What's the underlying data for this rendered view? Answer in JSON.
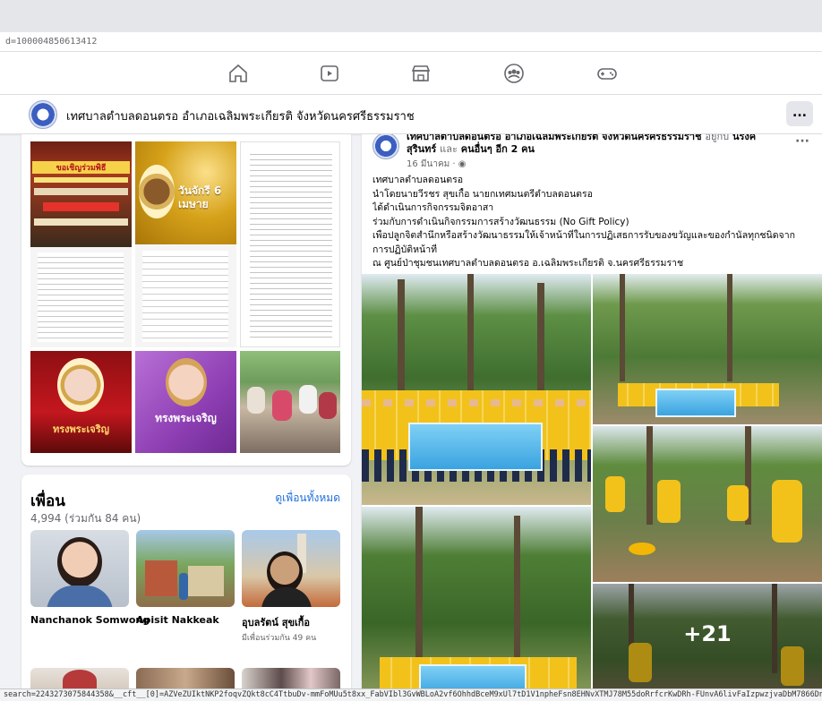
{
  "browser": {
    "url_fragment": "d=100004850613412",
    "status_url": "search=2243273075844358&__cft__[0]=AZVeZUIktNKP2foqvZQkt8cC4TtbuDv-mmFoMUu5t8xx_FabVIbl3GvWBLoA2vf6OhhdBceM9xUl7tD1V1npheFsn8EHNvXTMJ78M55doRrfcrKwDRh-FUnvA6livFaIzpwzjvaDbM7866DncBuP"
  },
  "nav": {
    "icons": [
      "home-icon",
      "watch-icon",
      "marketplace-icon",
      "groups-icon",
      "gaming-icon"
    ]
  },
  "page_header": {
    "title": "เทศบาลตำบลดอนตรอ อำเภอเฉลิมพระเกียรติ จังหวัดนครศรีธรรมราช",
    "more": "..."
  },
  "photos": {
    "tiles": [
      {
        "caption": "",
        "overlay_text": "ขอเชิญร่วมพิธี"
      },
      {
        "caption": "",
        "overlay_text": "วันจักรี 6 เมษาย"
      },
      {
        "caption": "",
        "overlay_text": ""
      },
      {
        "caption": "",
        "overlay_text": ""
      },
      {
        "caption": "",
        "overlay_text": ""
      },
      {
        "caption": "",
        "overlay_text": ""
      },
      {
        "caption": "",
        "overlay_text": "ทรงพระเจริญ"
      },
      {
        "caption": "",
        "overlay_text": "ทรงพระเจริญ"
      },
      {
        "caption": "",
        "overlay_text": ""
      }
    ]
  },
  "friends": {
    "title": "เพื่อน",
    "count": "4,994 (ร่วมกัน 84 คน)",
    "see_all": "ดูเพื่อนทั้งหมด",
    "items": [
      {
        "name": "Nanchanok Somwong",
        "mutual": ""
      },
      {
        "name": "Apisit Nakkeak",
        "mutual": ""
      },
      {
        "name": "อุบลรัตน์ สุขเกื้อ",
        "mutual": "มีเพื่อนร่วมกัน 49 คน"
      }
    ]
  },
  "post": {
    "author_line": "เทศบาลตำบลดอนตรอ อำเภอเฉลิมพระเกียรติ จังหวัดนครศรีธรรมราช",
    "with_text": "อยู่กับ",
    "tagged": "นรงค์ สุรินทร์",
    "and_text": "และ",
    "others": "คนอื่นๆ อีก 2 คน",
    "time": "16 มีนาคม · ",
    "more": "···",
    "lines": [
      "เทศบาลตำบลดอนตรอ",
      "นำโดยนายวีรชร สุขเกื้อ นายกเทศมนตรีตำบลดอนตรอ",
      "ได้ดำเนินการกิจกรรมจิตอาสา",
      "ร่วมกับการดำเนินกิจกรรมการสร้างวัฒนธรรม (No Gift Policy)",
      "เพื่อปลูกจิตสำนึกหรือสร้างวัฒนาธรรมให้เจ้าหน้าที่ในการปฏิเสธการรับของขวัญและของกำนัลทุกชนิดจาก",
      "การปฏิบัติหน้าที่",
      "ณ ศูนย์ป่าชุมชนเทศบาลตำบลดอนตรอ อ.เฉลิมพระเกียรติ จ.นครศรีธรรมราช"
    ],
    "more_photos": "+21"
  },
  "colors": {
    "link": "#216fdb",
    "secondary_text": "#65676b",
    "background": "#f0f2f5",
    "shirt_yellow": "#f2c21b",
    "banner_blue": "#3aa3e0"
  }
}
